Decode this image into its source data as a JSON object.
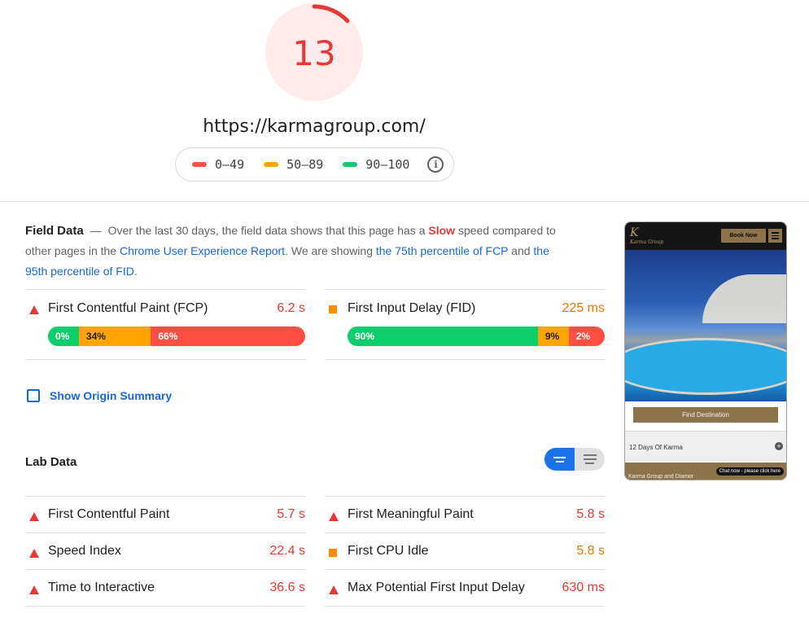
{
  "score": {
    "value": "13",
    "fraction": 0.13,
    "color": "#e53935"
  },
  "url": "https://karmagroup.com/",
  "legend": {
    "items": [
      {
        "label": "0–49",
        "color": "#ff4e42"
      },
      {
        "label": "50–89",
        "color": "#ffa400"
      },
      {
        "label": "90–100",
        "color": "#0cce6b"
      }
    ],
    "info_icon": "info-icon"
  },
  "field": {
    "title": "Field Data",
    "dash": "—",
    "text1": "Over the last 30 days, the field data shows that this page has a",
    "slow": "Slow",
    "text2": "speed compared to other pages in the",
    "link1": "Chrome User Experience Report",
    "text3": ". We are showing",
    "link2": "the 75th percentile of FCP",
    "text4": "and",
    "link3": "the 95th percentile of FID",
    "text5": ".",
    "metrics": [
      {
        "name": "First Contentful Paint (FCP)",
        "value": "6.2 s",
        "status": "fail",
        "dist": [
          {
            "label": "0%",
            "pct": 12,
            "color": "#0cce6b"
          },
          {
            "label": "34%",
            "pct": 28,
            "color": "#ffa400"
          },
          {
            "label": "66%",
            "pct": 60,
            "color": "#ff4e42"
          }
        ]
      },
      {
        "name": "First Input Delay (FID)",
        "value": "225 ms",
        "status": "average",
        "dist": [
          {
            "label": "90%",
            "pct": 74,
            "color": "#0cce6b"
          },
          {
            "label": "9%",
            "pct": 12,
            "color": "#ffa400"
          },
          {
            "label": "2%",
            "pct": 14,
            "color": "#ff4e42"
          }
        ]
      }
    ]
  },
  "origin": {
    "label": "Show Origin Summary"
  },
  "lab": {
    "title": "Lab Data",
    "left": [
      {
        "name": "First Contentful Paint",
        "value": "5.7 s",
        "status": "fail"
      },
      {
        "name": "Speed Index",
        "value": "22.4 s",
        "status": "fail"
      },
      {
        "name": "Time to Interactive",
        "value": "36.6 s",
        "status": "fail"
      }
    ],
    "right": [
      {
        "name": "First Meaningful Paint",
        "value": "5.8 s",
        "status": "fail"
      },
      {
        "name": "First CPU Idle",
        "value": "5.8 s",
        "status": "average"
      },
      {
        "name": "Max Potential First Input Delay",
        "value": "630 ms",
        "status": "fail"
      }
    ]
  },
  "thumbnail": {
    "logo": "K",
    "logo_sub": "Karma Group",
    "book_now": "Book Now",
    "find_destination": "Find Destination",
    "tour": "12 Days Of Karma",
    "footer": "Karma Group and Diamor",
    "chat": "Chat now - please click here"
  }
}
